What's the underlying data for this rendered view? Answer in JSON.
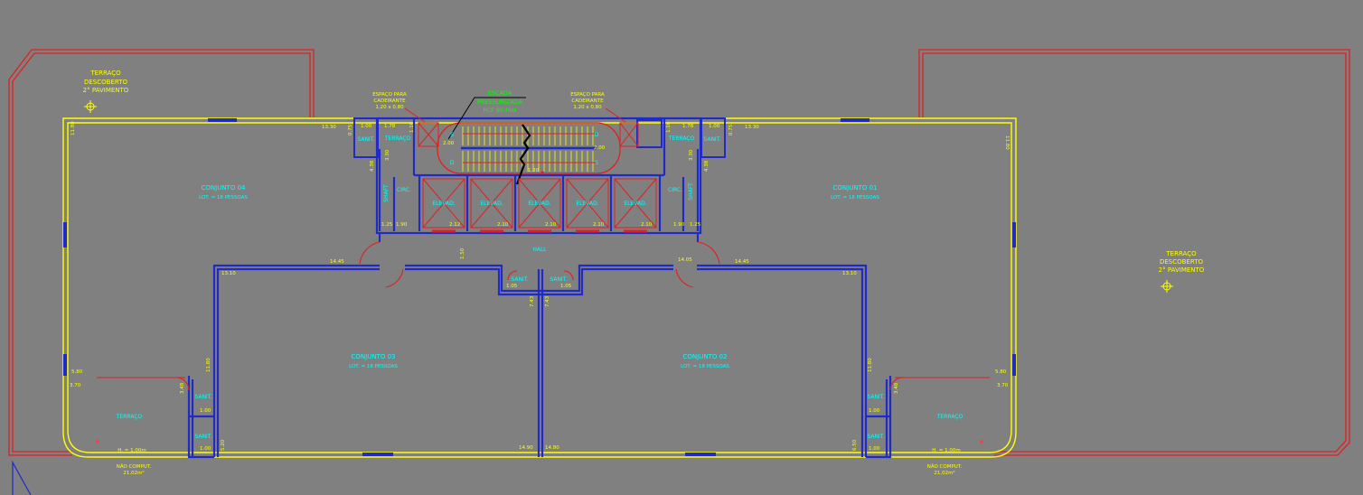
{
  "colors": {
    "background": "#808080",
    "boundary_red": "#e02020",
    "wall_yellow": "#ffff00",
    "wall_blue": "#1f2ac8",
    "label_cyan": "#00ffff",
    "label_green": "#00ff00",
    "accent_red": "#ff3b3b"
  },
  "terrace_top_left": {
    "line1": "TERRAÇO",
    "line2": "DESCOBERTO",
    "line3": "2° PAVIMENTO"
  },
  "terrace_right": {
    "line1": "TERRAÇO",
    "line2": "DESCOBERTO",
    "line3": "2° PAVIMENTO"
  },
  "espaco_left": {
    "line1": "ESPAÇO PARA",
    "line2": "CADEIRANTE",
    "line3": "1,20 x 0,80"
  },
  "espaco_right": {
    "line1": "ESPAÇO PARA",
    "line2": "CADEIRANTE",
    "line3": "1,20 x 0,80"
  },
  "green_note": {
    "line1": "ESCADA",
    "line2": "PRESSURIZADA",
    "line3": "PCF 90 MIN"
  },
  "units": {
    "c04": {
      "name": "CONJUNTO 04",
      "lot": "LOT. = 18 PESSOAS"
    },
    "c01": {
      "name": "CONJUNTO 01",
      "lot": "LOT. = 18 PESSOAS"
    },
    "c03": {
      "name": "CONJUNTO 03",
      "lot": "LOT. = 18 PESSOAS"
    },
    "c02": {
      "name": "CONJUNTO 02",
      "lot": "LOT. = 18 PESSOAS"
    }
  },
  "rooms": {
    "sanit": "SANIT.",
    "terraco": "TERRAÇO",
    "circ": "CIRC.",
    "shaft": "SHAFT",
    "elevad": "ELEVAD.",
    "hall": "HALL"
  },
  "bottom_left": {
    "note": "H. = 1,00m",
    "line1": "NÃO COMPUT.",
    "line2": "21,02m²"
  },
  "bottom_right": {
    "note": "H. = 1,00m",
    "line1": "NÃO COMPUT.",
    "line2": "21,02m²"
  },
  "dims": {
    "d1180": "11.80",
    "d1330": "13.30",
    "d100": "1.00",
    "d178": "1.78",
    "d075": "0.75",
    "d1445": "14.45",
    "d1405": "14.05",
    "d1310": "13.10",
    "d580": "5.80",
    "d370": "3.70",
    "d1490": "14.90",
    "d1480": "14.80",
    "d200": "2.00",
    "d120": "1.20",
    "d190": "1.90",
    "d125": "1.25",
    "d210": "2.10",
    "d212": "2.12",
    "d150": "1.50",
    "d743": "7.43",
    "d105": "1.05",
    "d348": "3.48",
    "d330": "3.30",
    "d438": "4.38",
    "d116": "1.16",
    "d440": "4.40",
    "d520": "5.20",
    "d650": "6.50"
  },
  "stair_marks": {
    "s": "S",
    "d": "D"
  }
}
